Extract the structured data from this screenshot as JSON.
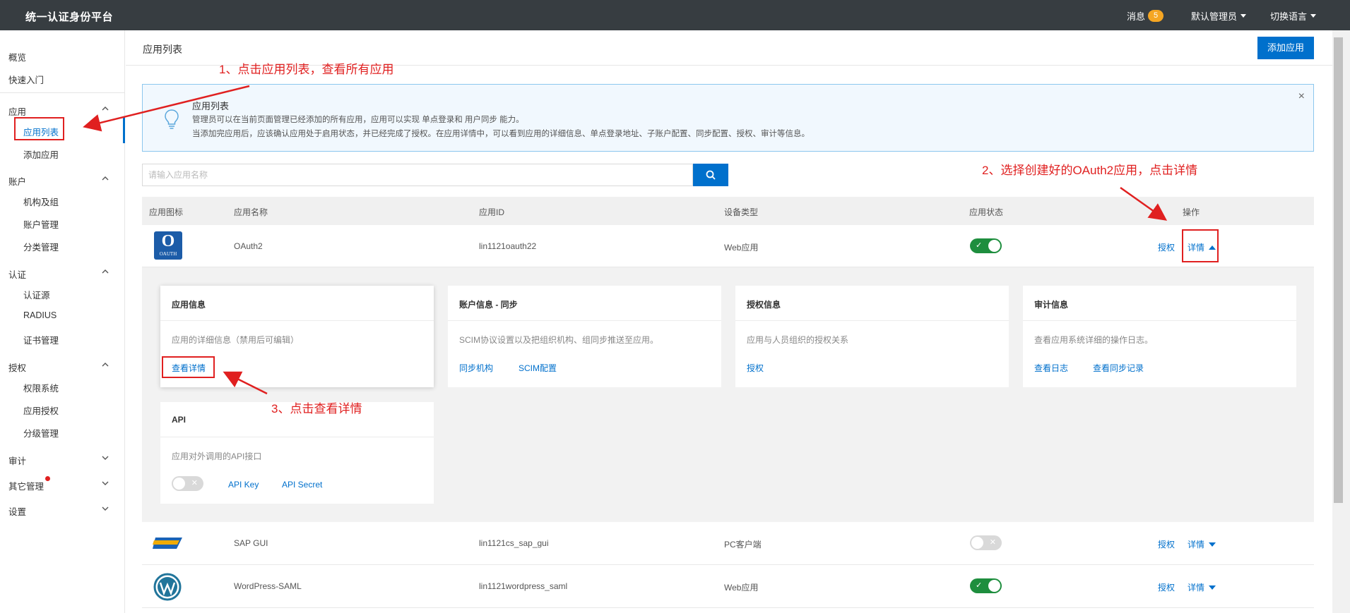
{
  "topbar": {
    "brand": "统一认证身份平台",
    "messages_label": "消息",
    "messages_count": "5",
    "user_label": "默认管理员",
    "language_label": "切换语言"
  },
  "sidebar": {
    "overview": "概览",
    "quick_start": "快速入门",
    "groups": [
      {
        "label": "应用",
        "expanded": true,
        "items": [
          "应用列表",
          "添加应用"
        ]
      },
      {
        "label": "账户",
        "expanded": true,
        "items": [
          "机构及组",
          "账户管理",
          "分类管理"
        ]
      },
      {
        "label": "认证",
        "expanded": true,
        "items": [
          "认证源",
          "RADIUS",
          "证书管理"
        ]
      },
      {
        "label": "授权",
        "expanded": true,
        "items": [
          "权限系统",
          "应用授权",
          "分级管理"
        ]
      },
      {
        "label": "审计",
        "expanded": false,
        "items": []
      },
      {
        "label": "其它管理",
        "expanded": false,
        "items": [],
        "has_dot": true
      },
      {
        "label": "设置",
        "expanded": false,
        "items": []
      }
    ],
    "active_item": "应用列表"
  },
  "page": {
    "title": "应用列表",
    "add_button": "添加应用"
  },
  "info_box": {
    "title": "应用列表",
    "line1": "管理员可以在当前页面管理已经添加的所有应用，应用可以实现 单点登录和 用户同步 能力。",
    "line2": "当添加完应用后，应该确认应用处于启用状态，并已经完成了授权。在应用详情中，可以看到应用的详细信息、单点登录地址、子账户配置、同步配置、授权、审计等信息。",
    "close": "×"
  },
  "search": {
    "placeholder": "请输入应用名称",
    "value": ""
  },
  "table": {
    "headers": [
      "应用图标",
      "应用名称",
      "应用ID",
      "设备类型",
      "应用状态",
      "操作"
    ],
    "rows": [
      {
        "icon": "oauth-logo",
        "logo_text": "O",
        "logo_sub": "OAUTH",
        "name": "OAuth2",
        "id": "lin1121oauth22",
        "device": "Web应用",
        "enabled": true,
        "auth": "授权",
        "detail": "详情",
        "expanded": true
      },
      {
        "icon": "sap-logo",
        "name": "SAP GUI",
        "id": "lin1121cs_sap_gui",
        "device": "PC客户端",
        "enabled": false,
        "auth": "授权",
        "detail": "详情",
        "expanded": false
      },
      {
        "icon": "wordpress-logo",
        "name": "WordPress-SAML",
        "id": "lin1121wordpress_saml",
        "device": "Web应用",
        "enabled": true,
        "auth": "授权",
        "detail": "详情",
        "expanded": false
      }
    ]
  },
  "detail_cards": {
    "app_info": {
      "title": "应用信息",
      "desc": "应用的详细信息（禁用后可编辑）",
      "link": "查看详情"
    },
    "account_sync": {
      "title": "账户信息 - 同步",
      "desc": "SCIM协议设置以及把组织机构、组同步推送至应用。",
      "link1": "同步机构",
      "link2": "SCIM配置"
    },
    "auth_info": {
      "title": "授权信息",
      "desc": "应用与人员组织的授权关系",
      "link": "授权"
    },
    "audit_info": {
      "title": "审计信息",
      "desc": "查看应用系统详细的操作日志。",
      "link1": "查看日志",
      "link2": "查看同步记录"
    },
    "api": {
      "title": "API",
      "desc": "应用对外调用的API接口",
      "enabled": false,
      "link1": "API Key",
      "link2": "API Secret"
    }
  },
  "annotations": {
    "step1": "1、点击应用列表，查看所有应用",
    "step2": "2、选择创建好的OAuth2应用，点击详情",
    "step3": "3、点击查看详情"
  },
  "colors": {
    "topbar": "#373d41",
    "primary": "#0070cc",
    "toggle_on": "#1e8e3e",
    "annotation": "#e02020",
    "badge": "#f5a623"
  }
}
